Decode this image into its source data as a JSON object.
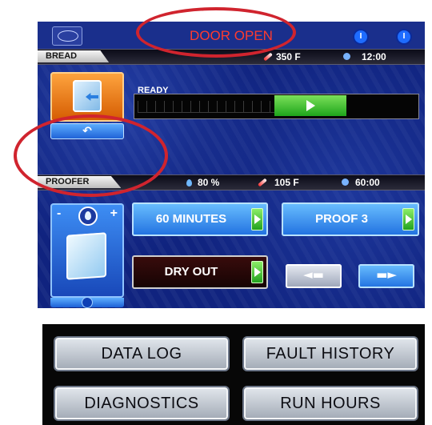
{
  "status": {
    "door_message": "DOOR OPEN"
  },
  "bread": {
    "label": "BREAD",
    "temperature": "350 F",
    "timer": "12:00",
    "state": "READY",
    "progress_fraction": 0.75
  },
  "proofer": {
    "label": "PROOFER",
    "humidity": "80 %",
    "temperature": "105 F",
    "timer": "60:00",
    "buttons": {
      "minutes": "60 MINUTES",
      "proof": "PROOF 3",
      "dry_out": "DRY OUT"
    },
    "minus": "-",
    "plus": "+"
  },
  "menu": {
    "data_log": "DATA LOG",
    "fault_history": "FAULT HISTORY",
    "diagnostics": "DIAGNOSTICS",
    "run_hours": "RUN HOURS"
  },
  "colors": {
    "screen_bg": "#10237f",
    "annotation": "#d0242e",
    "progress_green": "#1ea51b",
    "oven_orange": "#d45a00"
  },
  "icons": {
    "back": "back-arrow-icon",
    "prev": "previous-icon",
    "next": "next-icon"
  }
}
